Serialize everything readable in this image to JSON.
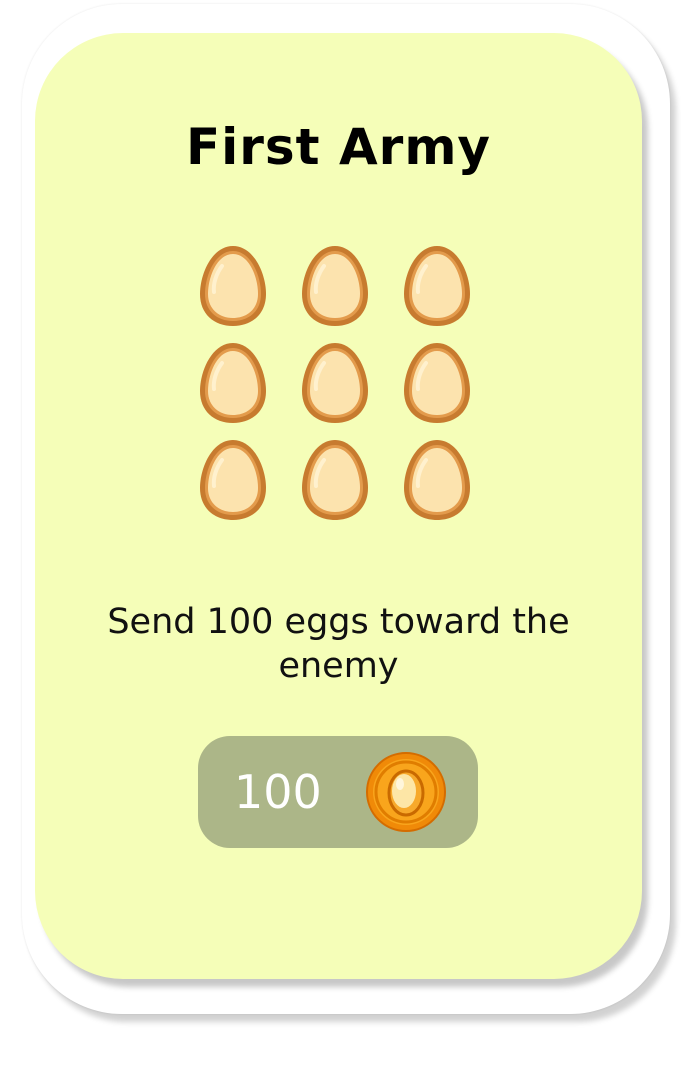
{
  "card": {
    "title": "First Army",
    "description": "Send 100 eggs toward the enemy",
    "egg_count_shown": 9,
    "egg_icon": "egg-icon",
    "price": {
      "value": "100",
      "currency_icon": "gold-egg-coin-icon"
    }
  },
  "colors": {
    "card_background": "#f5feb8",
    "card_border": "#ffffff",
    "price_button": "#acb688",
    "price_text": "#ffffff",
    "egg_fill": "#fce3ae",
    "egg_outline": "#c77b2f",
    "coin": "#f5920e"
  }
}
